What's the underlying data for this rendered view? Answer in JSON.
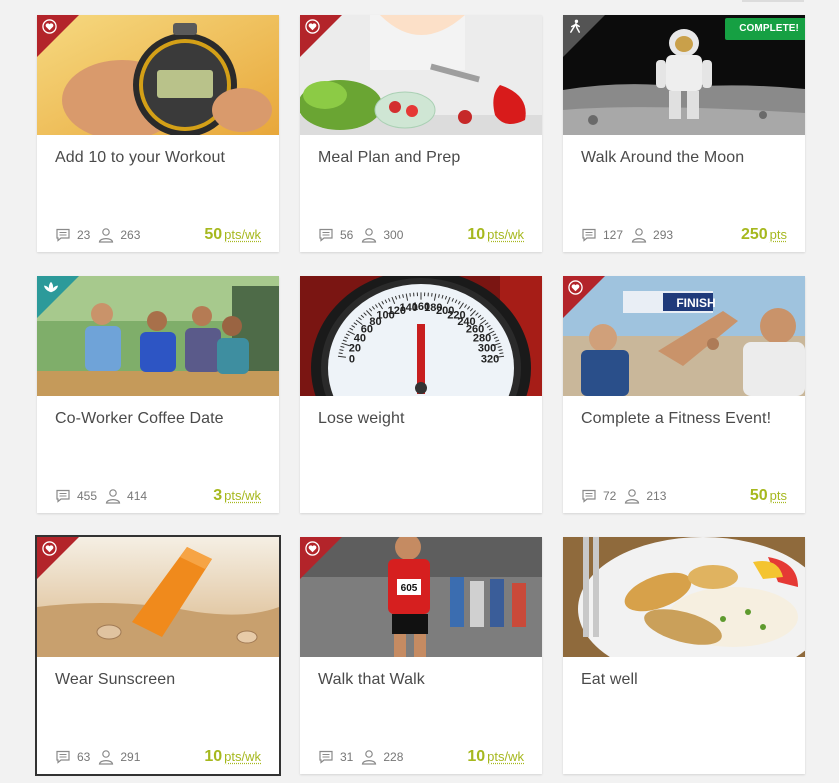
{
  "colors": {
    "points": "#a6b81e",
    "complete_badge": "#16a043",
    "corner_red": "#b3242a",
    "corner_gray": "#545454",
    "corner_teal": "#2c9a9a"
  },
  "cards": [
    {
      "title": "Add 10 to your Workout",
      "comments": "23",
      "participants": "263",
      "points": "50",
      "unit": "pts/wk",
      "corner_icon": "heart-icon",
      "image": "stopwatch"
    },
    {
      "title": "Meal Plan and Prep",
      "comments": "56",
      "participants": "300",
      "points": "10",
      "unit": "pts/wk",
      "corner_icon": "heart-icon",
      "image": "vegetables"
    },
    {
      "title": "Walk Around the Moon",
      "comments": "127",
      "participants": "293",
      "points": "250",
      "unit": "pts",
      "corner_icon": "walker-icon",
      "badge": "COMPLETE!",
      "image": "astronaut"
    },
    {
      "title": "Co-Worker Coffee Date",
      "comments": "455",
      "participants": "414",
      "points": "3",
      "unit": "pts/wk",
      "corner_icon": "lotus-icon",
      "image": "coworkers"
    },
    {
      "title": "Lose weight",
      "image": "scale",
      "scale_numbers": [
        "160",
        "180",
        "140",
        "200",
        "120",
        "220",
        "100",
        "240",
        "80",
        "260",
        "60",
        "280",
        "40",
        "300",
        "20",
        "0",
        "320"
      ]
    },
    {
      "title": "Complete a Fitness Event!",
      "comments": "72",
      "participants": "213",
      "points": "50",
      "unit": "pts",
      "corner_icon": "heart-icon",
      "image": "finish-line",
      "banner_text": "FINISH"
    },
    {
      "title": "Wear Sunscreen",
      "comments": "63",
      "participants": "291",
      "points": "10",
      "unit": "pts/wk",
      "corner_icon": "heart-icon",
      "image": "sunscreen",
      "selected": true
    },
    {
      "title": "Walk that Walk",
      "comments": "31",
      "participants": "228",
      "points": "10",
      "unit": "pts/wk",
      "corner_icon": "heart-icon",
      "image": "runners",
      "bib_text": "605"
    },
    {
      "title": "Eat well",
      "image": "chicken-rice"
    }
  ]
}
